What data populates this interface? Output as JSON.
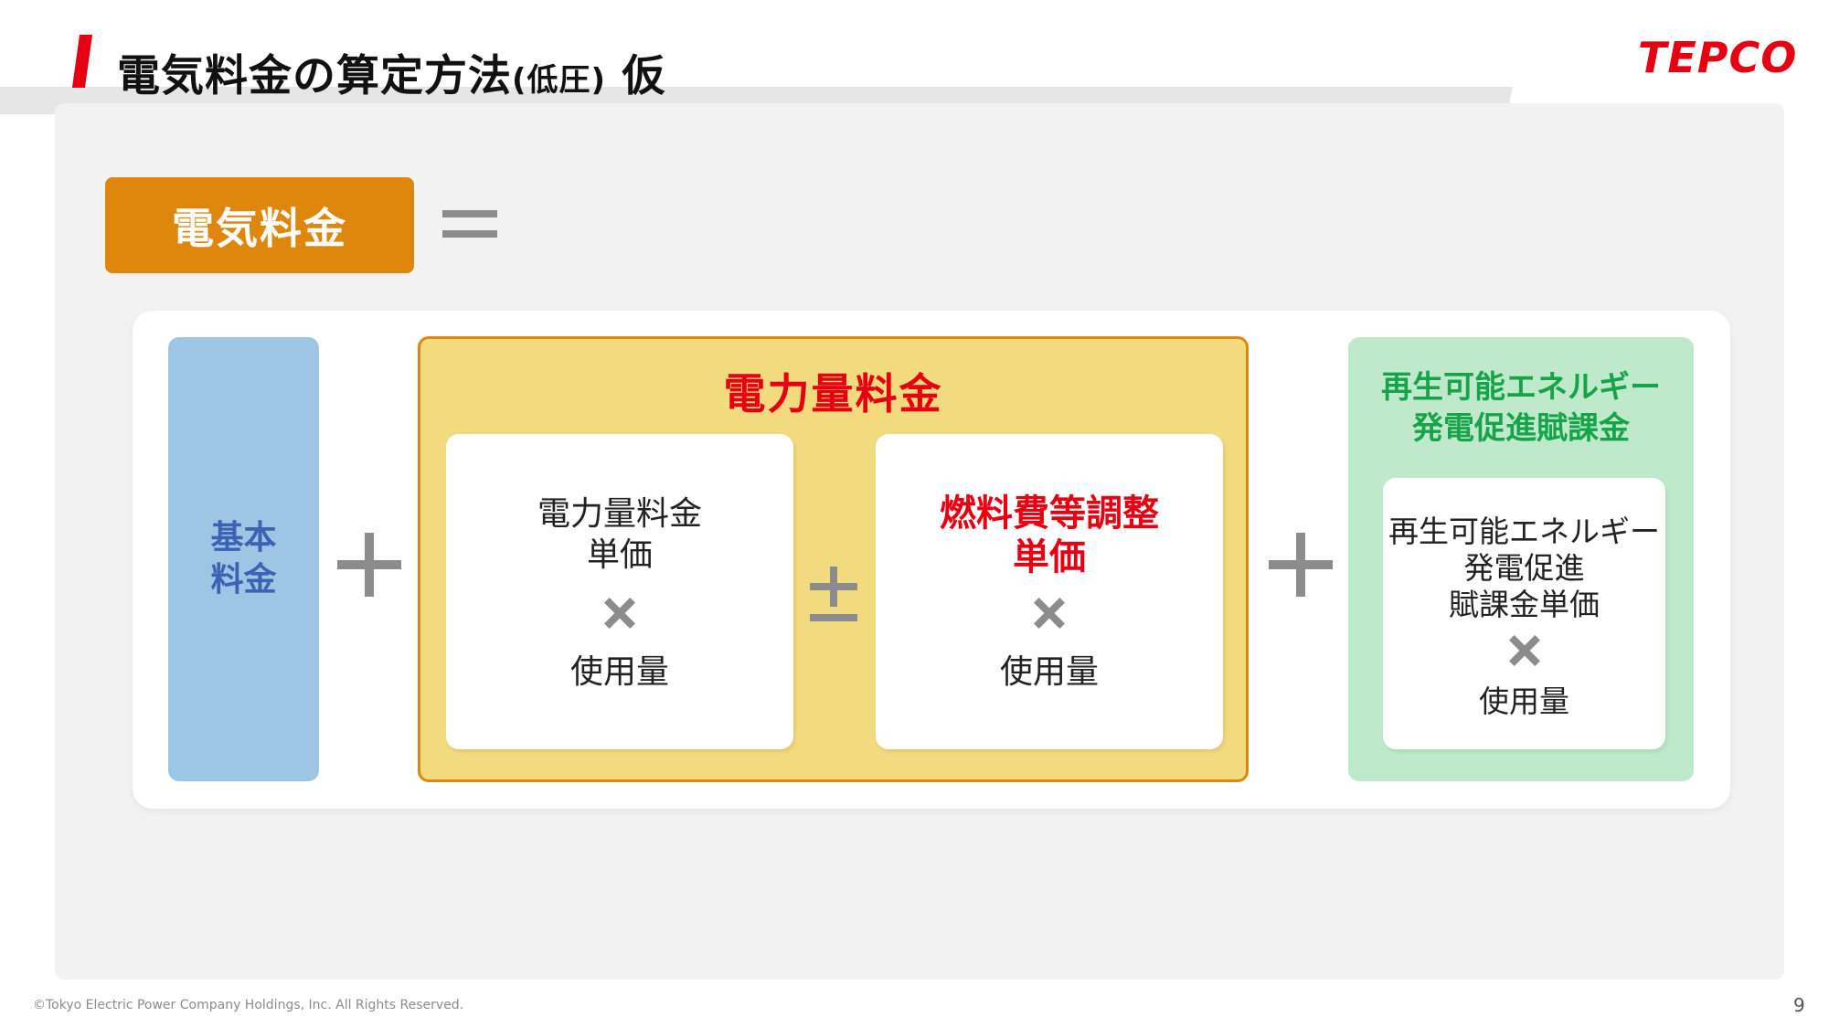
{
  "header": {
    "title_main": "電気料金の算定方法",
    "title_sub": "(低圧)",
    "title_suffix": "仮",
    "logo": "TEPCO"
  },
  "formula": {
    "lhs": "電気料金",
    "basic": {
      "line1": "基本",
      "line2": "料金"
    },
    "energy": {
      "title": "電力量料金",
      "card_unit": {
        "line1": "電力量料金",
        "line2": "単価",
        "usage": "使用量"
      },
      "card_fuel": {
        "line1": "燃料費等調整",
        "line2": "単価",
        "usage": "使用量"
      }
    },
    "renewable": {
      "title_line1": "再生可能エネルギー",
      "title_line2": "発電促進賦課金",
      "card_line1": "再生可能エネルギー",
      "card_line2": "発電促進",
      "card_line3": "賦課金単価",
      "usage": "使用量"
    }
  },
  "footer": {
    "copyright": "©Tokyo Electric Power Company Holdings, Inc. All Rights Reserved.",
    "page_number": "9"
  },
  "colors": {
    "accent_red": "#e60012",
    "orange": "#df870c",
    "basic_blue": "#9ec5e3",
    "energy_yellow": "#f2da7e",
    "renew_green": "#bfe9cb",
    "renew_text": "#16a34a"
  }
}
